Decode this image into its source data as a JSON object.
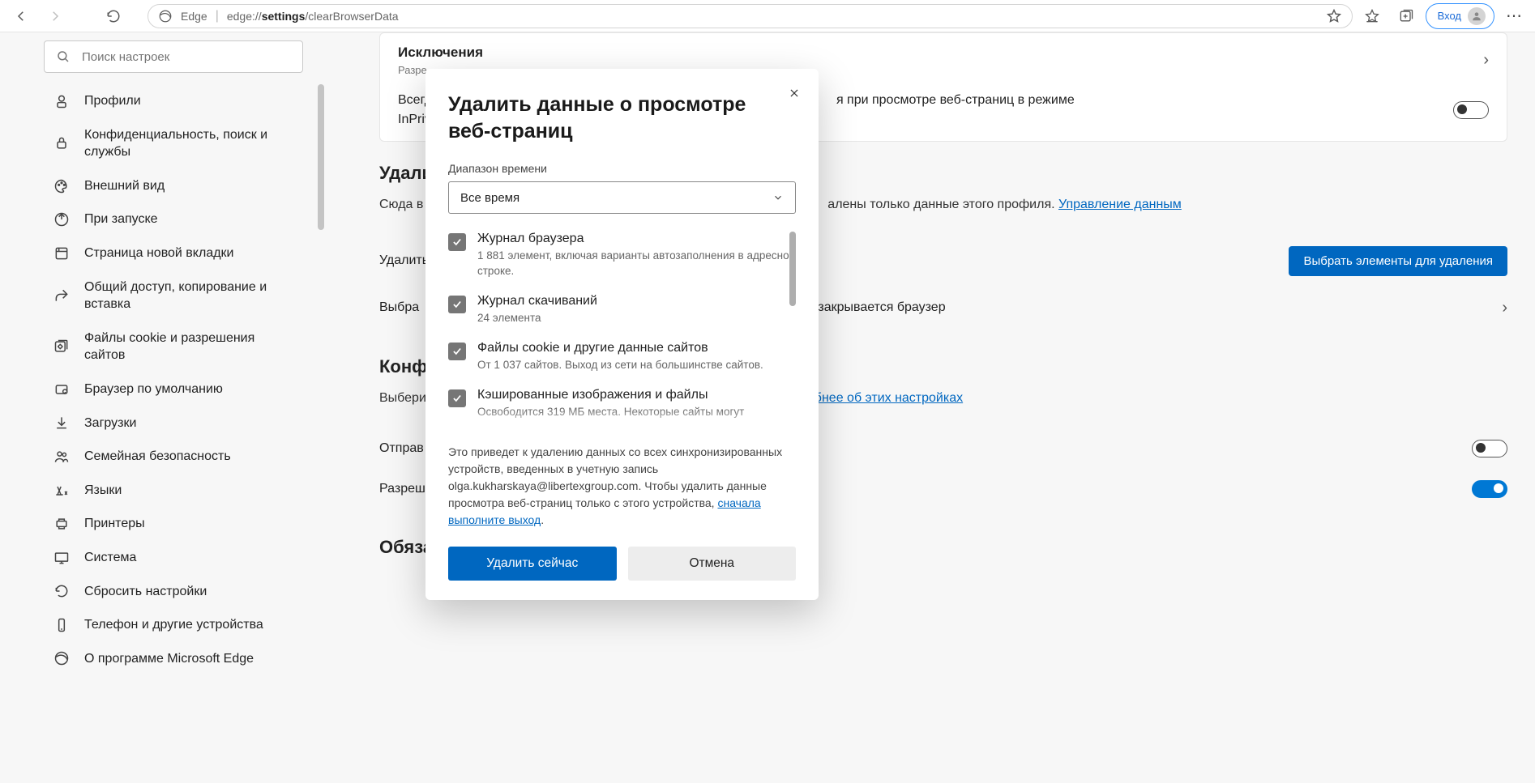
{
  "addressBar": {
    "brand": "Edge",
    "urlPrefix": "edge://",
    "urlBold": "settings",
    "urlSuffix": "/clearBrowserData"
  },
  "chrome": {
    "login": "Вход"
  },
  "sidebar": {
    "searchPlaceholder": "Поиск настроек",
    "items": [
      "Профили",
      "Конфиденциальность, поиск и службы",
      "Внешний вид",
      "При запуске",
      "Страница новой вкладки",
      "Общий доступ, копирование и вставка",
      "Файлы cookie и разрешения сайтов",
      "Браузер по умолчанию",
      "Загрузки",
      "Семейная безопасность",
      "Языки",
      "Принтеры",
      "Система",
      "Сбросить настройки",
      "Телефон и другие устройства",
      "О программе Microsoft Edge"
    ]
  },
  "page": {
    "exceptions": {
      "title": "Исключения",
      "sub": "Разре"
    },
    "inprivateRow": {
      "before": "Всегд",
      "after": "я при просмотре веб-страниц в режиме InPrivate"
    },
    "section1": "Удали",
    "bodyLine": {
      "before": "Сюда в",
      "mid": "алены только данные этого профиля. ",
      "link": "Управление данным"
    },
    "deleteRow": "Удалить",
    "deleteBtn": "Выбрать элементы для удаления",
    "closeBrowserRow": {
      "before": "Выбра",
      "after": "а закрывается браузер"
    },
    "section2": "Конф",
    "bodyLine2": {
      "before": "Выбери",
      "link": "бнее об этих настройках"
    },
    "row3": "Отправ",
    "row4": "Разреш",
    "section3": "Обяза"
  },
  "modal": {
    "title": "Удалить данные о просмотре веб-страниц",
    "rangeLabel": "Диапазон времени",
    "rangeValue": "Все время",
    "items": [
      {
        "title": "Журнал браузера",
        "desc": "1 881 элемент, включая варианты автозаполнения в адресной строке."
      },
      {
        "title": "Журнал скачиваний",
        "desc": "24 элемента"
      },
      {
        "title": "Файлы cookie и другие данные сайтов",
        "desc": "От 1 037 сайтов. Выход из сети на большинстве сайтов."
      },
      {
        "title": "Кэшированные изображения и файлы",
        "desc": "Освободится 319 МБ места. Некоторые сайты могут"
      }
    ],
    "note": {
      "text1": "Это приведет к удалению данных со всех синхронизированных устройств, введенных в учетную запись olga.kukharskaya@libertexgroup.com. Чтобы удалить данные просмотра веб-страниц только с этого устройства, ",
      "link": "сначала выполните выход",
      "text2": "."
    },
    "primary": "Удалить сейчас",
    "secondary": "Отмена"
  }
}
